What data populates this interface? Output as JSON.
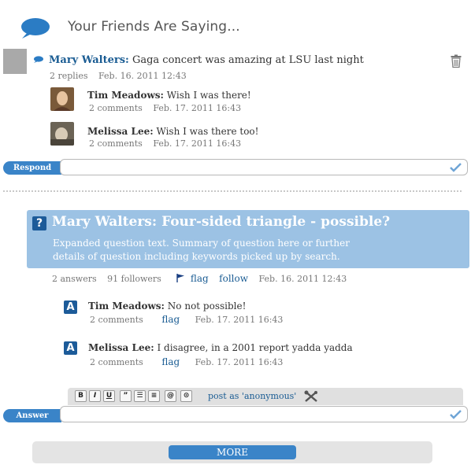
{
  "header": {
    "title": "Your Friends Are Saying..."
  },
  "post": {
    "author": "Mary Walters:",
    "text": "Gaga concert was amazing at LSU last night",
    "replies": "2 replies",
    "date": "Feb. 16. 2011 12:43",
    "comments": [
      {
        "author": "Tim Meadows:",
        "text": "Wish I was there!",
        "count": "2 comments",
        "date": "Feb. 17. 2011 16:43"
      },
      {
        "author": "Melissa Lee:",
        "text": "Wish I was there too!",
        "count": "2 comments",
        "date": "Feb. 17. 2011 16:43"
      }
    ],
    "respond_label": "Respond"
  },
  "question": {
    "title": "Mary Walters: Four-sided triangle - possible?",
    "body_line1": "Expanded question text. Summary of question here or further",
    "body_line2": "details of question including keywords picked up by search.",
    "answers": "2 answers",
    "followers": "91 followers",
    "flag": "flag",
    "follow": "follow",
    "date": "Feb. 16. 2011 12:43",
    "answer_items": [
      {
        "author": "Tim Meadows:",
        "text": "No not possible!",
        "count": "2 comments",
        "flag": "flag",
        "date": "Feb. 17. 2011 16:43"
      },
      {
        "author": "Melissa Lee:",
        "text": "I disagree, in a 2001 report yadda yadda",
        "count": "2 comments",
        "flag": "flag",
        "date": "Feb. 17. 2011 16:43"
      }
    ],
    "qmark": "?",
    "answer_icon": "A"
  },
  "editor": {
    "buttons": [
      "B",
      "I",
      "U",
      "”",
      "☰",
      "≡",
      "@",
      "⊙"
    ],
    "post_as": "post as 'anonymous'",
    "answer_label": "Answer"
  },
  "more": {
    "label": "MORE"
  },
  "colors": {
    "accent": "#3a84c8",
    "link": "#1a5c93",
    "question_bg": "#9cc2e4"
  },
  "icons": [
    "speech-bubble-icon",
    "trash-icon",
    "check-icon",
    "flag-icon",
    "tools-icon"
  ]
}
